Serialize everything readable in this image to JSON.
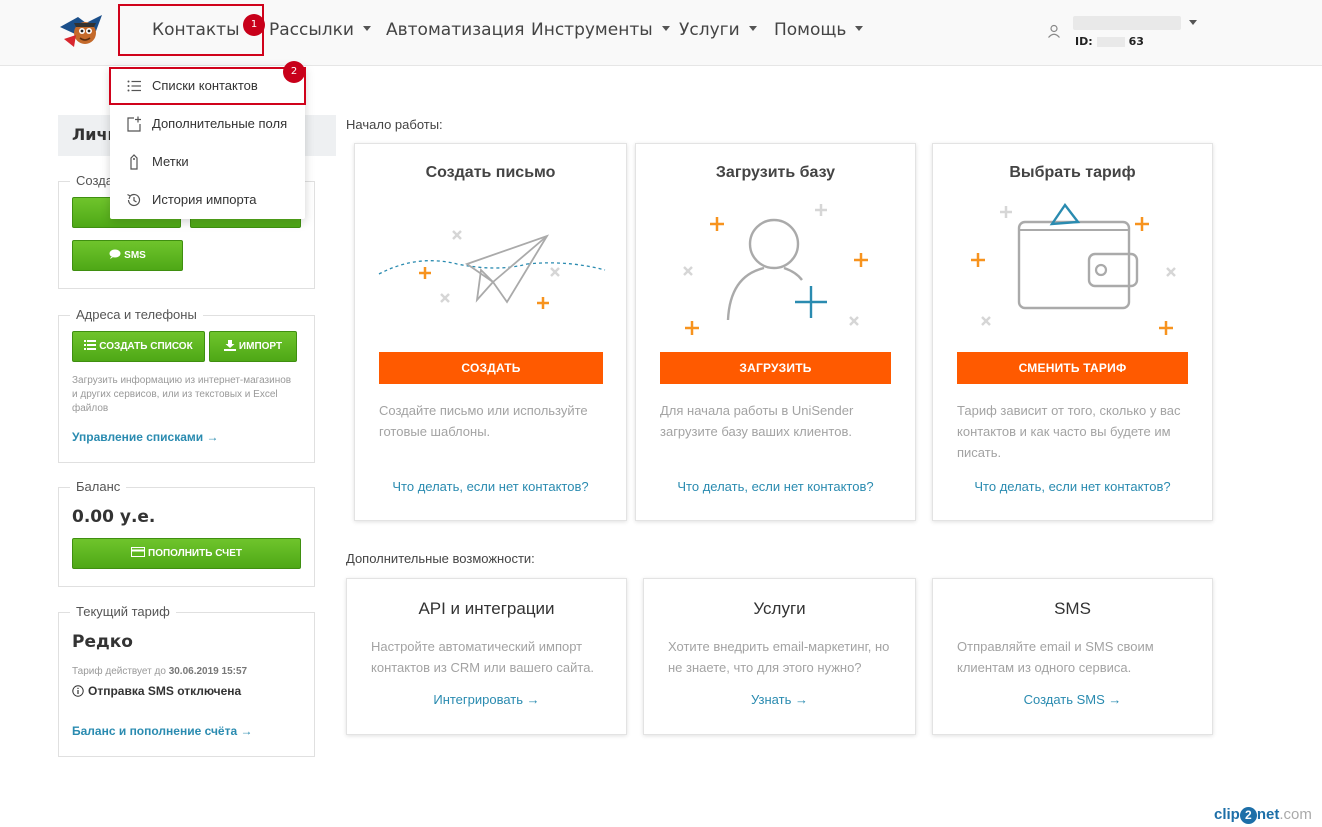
{
  "nav": {
    "items": [
      "Контакты",
      "Рассылки",
      "Автоматизация",
      "Инструменты",
      "Услуги",
      "Помощь"
    ],
    "badge1": "1",
    "badge2": "2",
    "user_id_prefix": "ID:",
    "user_id_suffix": "63"
  },
  "dropdown": {
    "items": [
      "Списки контактов",
      "Дополнительные поля",
      "Метки",
      "История импорта"
    ],
    "icons": [
      "list-icon",
      "add-field-icon",
      "tag-icon",
      "history-icon"
    ]
  },
  "sidebar": {
    "header": "Личн",
    "create": {
      "legend": "Созда",
      "sms_label": "SMS"
    },
    "addresses": {
      "legend": "Адреса и телефоны",
      "create_list": "СОЗДАТЬ СПИСОК",
      "import": "ИМПОРТ",
      "description": "Загрузить информацию из интернет-магазинов и других сервисов, или из текстовых и Excel файлов",
      "manage_link": "Управление списками →"
    },
    "balance": {
      "legend": "Баланс",
      "value": "0.00 у.е.",
      "topup": "ПОПОЛНИТЬ СЧЕТ"
    },
    "tariff": {
      "legend": "Текущий тариф",
      "name": "Редко",
      "valid_prefix": "Тариф действует до",
      "valid_date": "30.06.2019 15:57",
      "sms_status": "Отправка SMS отключена",
      "link": "Баланс и пополнение счёта →"
    }
  },
  "main": {
    "start_label": "Начало работы:",
    "cards": [
      {
        "title": "Создать письмо",
        "button": "СОЗДАТЬ",
        "description": "Создайте письмо или используйте готовые шаблоны.",
        "link": "Что делать, если нет контактов?",
        "icon": "paper-plane-icon"
      },
      {
        "title": "Загрузить базу",
        "button": "ЗАГРУЗИТЬ",
        "description": "Для начала работы в UniSender загрузите базу ваших клиентов.",
        "link": "Что делать, если нет контактов?",
        "icon": "add-user-icon"
      },
      {
        "title": "Выбрать тариф",
        "button": "СМЕНИТЬ ТАРИФ",
        "description": "Тариф зависит от того, сколько у вас контактов и как часто вы будете им писать.",
        "link": "Что делать, если нет контактов?",
        "icon": "wallet-icon"
      }
    ],
    "extra_label": "Дополнительные возможности:",
    "extras": [
      {
        "title": "API и интеграции",
        "description": "Настройте автоматический импорт контактов из CRM или вашего сайта.",
        "link": "Интегрировать →"
      },
      {
        "title": "Услуги",
        "description": "Хотите внедрить email-маркетинг, но не знаете, что для этого нужно?",
        "link": "Узнать →"
      },
      {
        "title": "SMS",
        "description": "Отправляйте email и SMS своим клиентам из одного сервиса.",
        "link": "Создать SMS →"
      }
    ]
  },
  "footer": {
    "brand_a": "clip",
    "brand_b": "2",
    "brand_c": "net",
    "brand_d": ".com"
  },
  "colors": {
    "accent_orange": "#ff5a00",
    "accent_green": "#5cb41e",
    "link_blue": "#2a8bb0",
    "highlight_red": "#d0021b",
    "illus_teal": "#2a8bb0",
    "illus_orange": "#f7931e"
  }
}
